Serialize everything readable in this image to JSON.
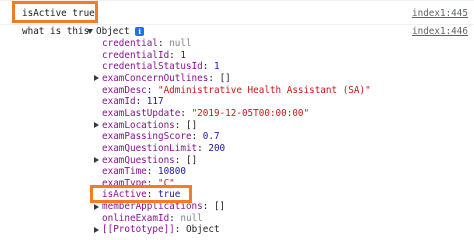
{
  "log1": {
    "text": "isActive true",
    "source": "index1:445"
  },
  "log2": {
    "label": "what is this",
    "type_label": "Object",
    "info_glyph": "i",
    "source": "index1:446"
  },
  "properties": [
    {
      "key": "credential",
      "value": "null",
      "kind": "null",
      "expandable": false
    },
    {
      "key": "credentialId",
      "value": "1",
      "kind": "num",
      "expandable": false
    },
    {
      "key": "credentialStatusId",
      "value": "1",
      "kind": "num",
      "expandable": false
    },
    {
      "key": "examConcernOutlines",
      "value": "[]",
      "kind": "plain",
      "expandable": true
    },
    {
      "key": "examDesc",
      "value": "\"Administrative Health Assistant (SA)\"",
      "kind": "str",
      "expandable": false
    },
    {
      "key": "examId",
      "value": "117",
      "kind": "num",
      "expandable": false
    },
    {
      "key": "examLastUpdate",
      "value": "\"2019-12-05T00:00:00\"",
      "kind": "str",
      "expandable": false
    },
    {
      "key": "examLocations",
      "value": "[]",
      "kind": "plain",
      "expandable": true
    },
    {
      "key": "examPassingScore",
      "value": "0.7",
      "kind": "num",
      "expandable": false
    },
    {
      "key": "examQuestionLimit",
      "value": "200",
      "kind": "num",
      "expandable": false
    },
    {
      "key": "examQuestions",
      "value": "[]",
      "kind": "plain",
      "expandable": true
    },
    {
      "key": "examTime",
      "value": "10800",
      "kind": "num",
      "expandable": false
    },
    {
      "key": "examType",
      "value": "\"C\"",
      "kind": "str",
      "expandable": false
    },
    {
      "key": "isActive",
      "value": "true",
      "kind": "bool",
      "expandable": false
    },
    {
      "key": "memberApplications",
      "value": "[]",
      "kind": "plain",
      "expandable": true
    },
    {
      "key": "onlineExamId",
      "value": "null",
      "kind": "null",
      "expandable": false
    },
    {
      "key": "[[Prototype]]",
      "value": "Object",
      "kind": "plain",
      "expandable": true
    }
  ],
  "highlight_color": "#f57c25"
}
